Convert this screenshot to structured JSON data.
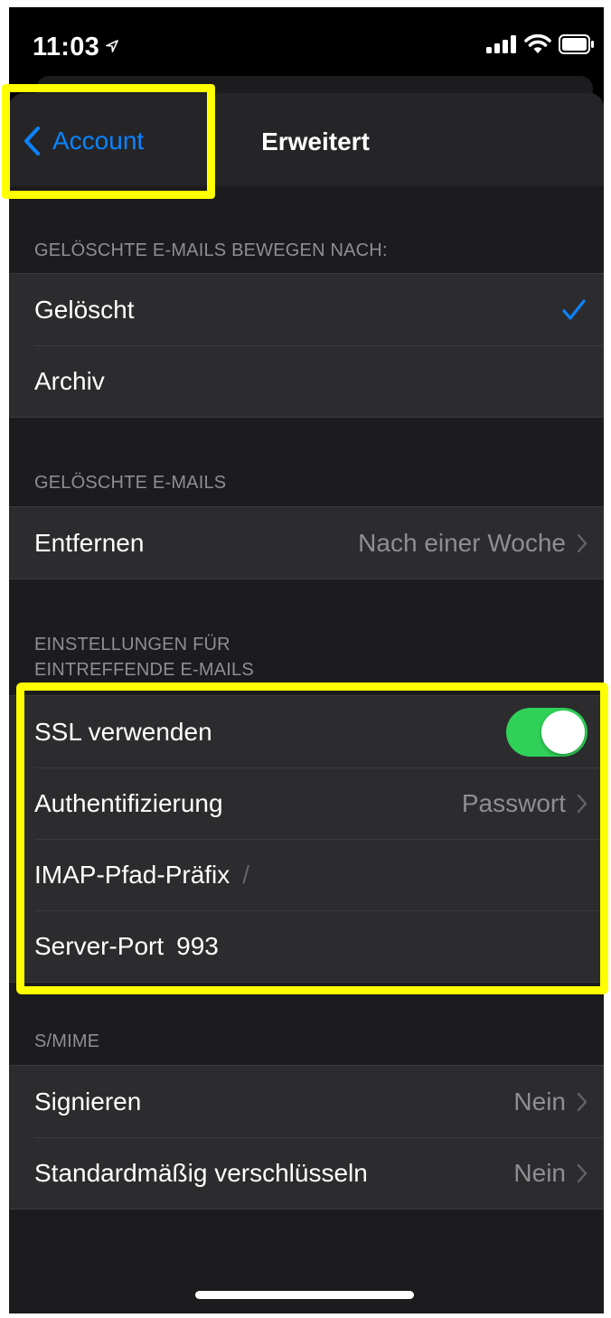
{
  "status_bar": {
    "time": "11:03",
    "icons": [
      "location-arrow-icon",
      "signal-icon",
      "wifi-icon",
      "battery-icon"
    ]
  },
  "nav": {
    "back_label": "Account",
    "title": "Erweitert"
  },
  "sections": {
    "move_deleted": {
      "header": "GELÖSCHTE E-MAILS BEWEGEN NACH:",
      "options": [
        {
          "label": "Gelöscht",
          "selected": true
        },
        {
          "label": "Archiv",
          "selected": false
        }
      ]
    },
    "deleted_mails": {
      "header": "GELÖSCHTE E-MAILS",
      "remove_label": "Entfernen",
      "remove_value": "Nach einer Woche"
    },
    "incoming": {
      "header_line1": "EINSTELLUNGEN FÜR",
      "header_line2": "EINTREFFENDE E-MAILS",
      "ssl_label": "SSL verwenden",
      "ssl_on": true,
      "auth_label": "Authentifizierung",
      "auth_value": "Passwort",
      "imap_label": "IMAP-Pfad-Präfix",
      "imap_value": "/",
      "port_label": "Server-Port",
      "port_value": "993"
    },
    "smime": {
      "header": "S/MIME",
      "sign_label": "Signieren",
      "sign_value": "Nein",
      "encrypt_label": "Standardmäßig verschlüsseln",
      "encrypt_value": "Nein"
    }
  },
  "colors": {
    "accent": "#0a84ff",
    "toggle_on": "#30d158",
    "highlight": "#ffff00"
  }
}
